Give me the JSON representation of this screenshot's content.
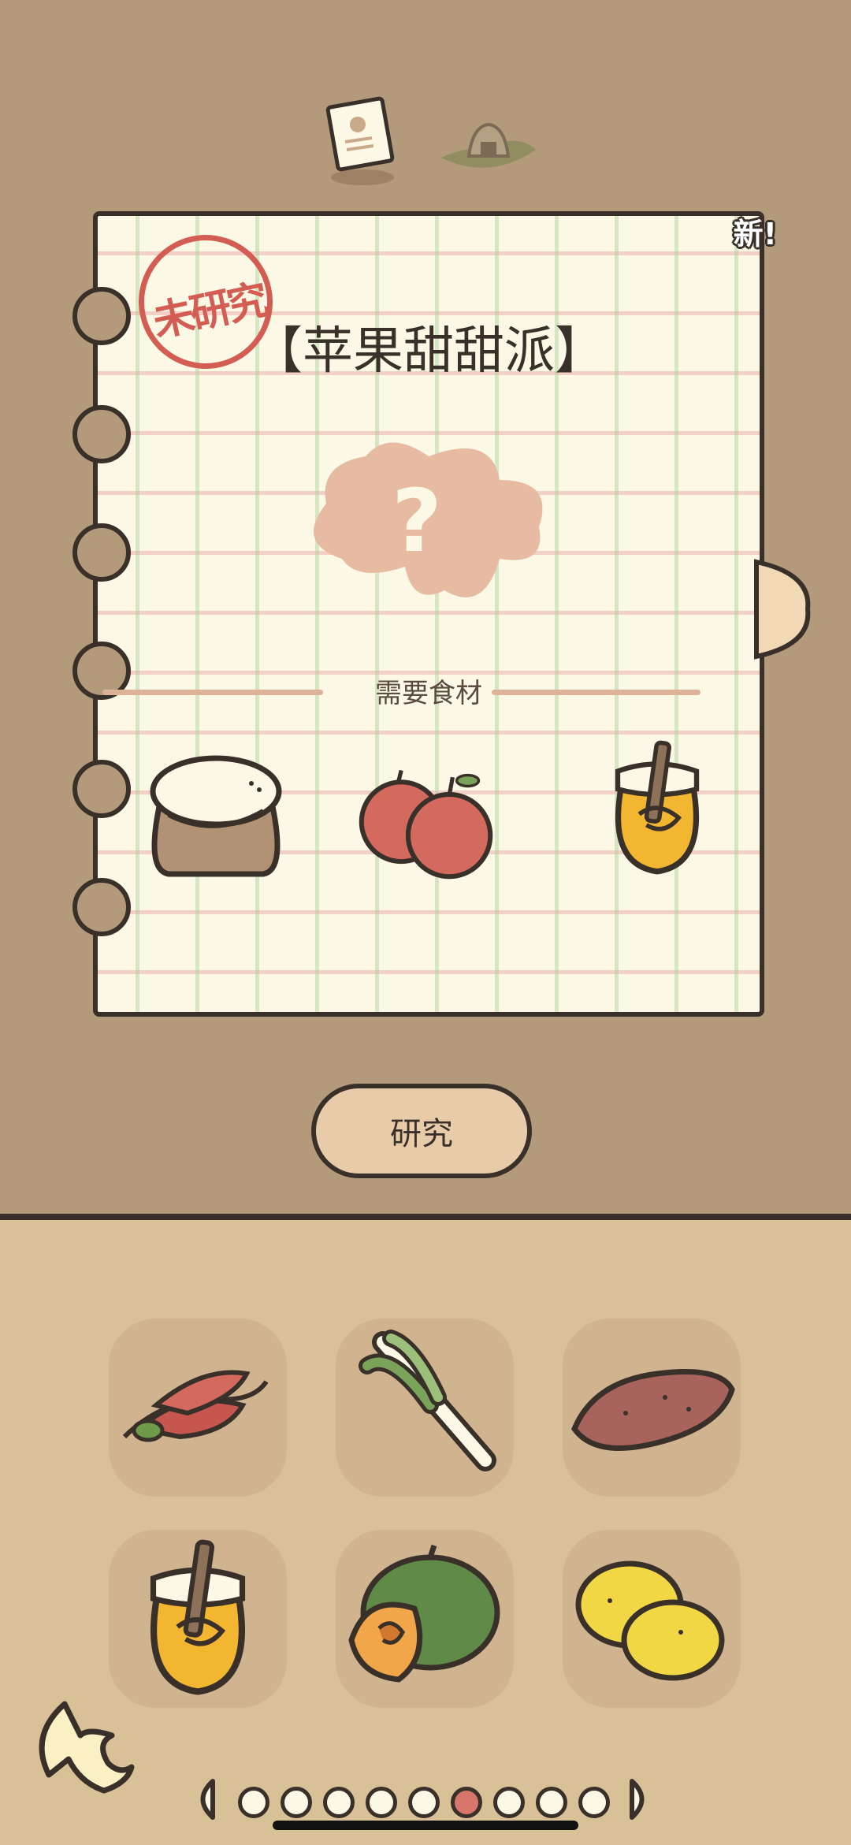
{
  "recipe": {
    "title": "【苹果甜甜派】",
    "stamp_text": "未研究",
    "new_badge": "新!",
    "mystery_mark": "?",
    "ingredients_label": "需要食材",
    "ingredients": [
      "flour-sack-icon",
      "apples-icon",
      "honey-jar-icon"
    ]
  },
  "actions": {
    "research_label": "研究"
  },
  "inventory": {
    "items": [
      "chili-peppers-icon",
      "green-onion-icon",
      "sweet-potato-icon",
      "honey-jar-icon",
      "pumpkin-icon",
      "lemons-icon"
    ]
  },
  "pager": {
    "page_count": 9,
    "current_page": 6
  },
  "colors": {
    "background": "#b39a7b",
    "paper": "#fbf8e6",
    "outline": "#3a302a",
    "stamp": "#d35d53",
    "inventory_bg": "#d9c197",
    "slot_bg": "#cfb48f",
    "active_dot": "#d8766c"
  }
}
